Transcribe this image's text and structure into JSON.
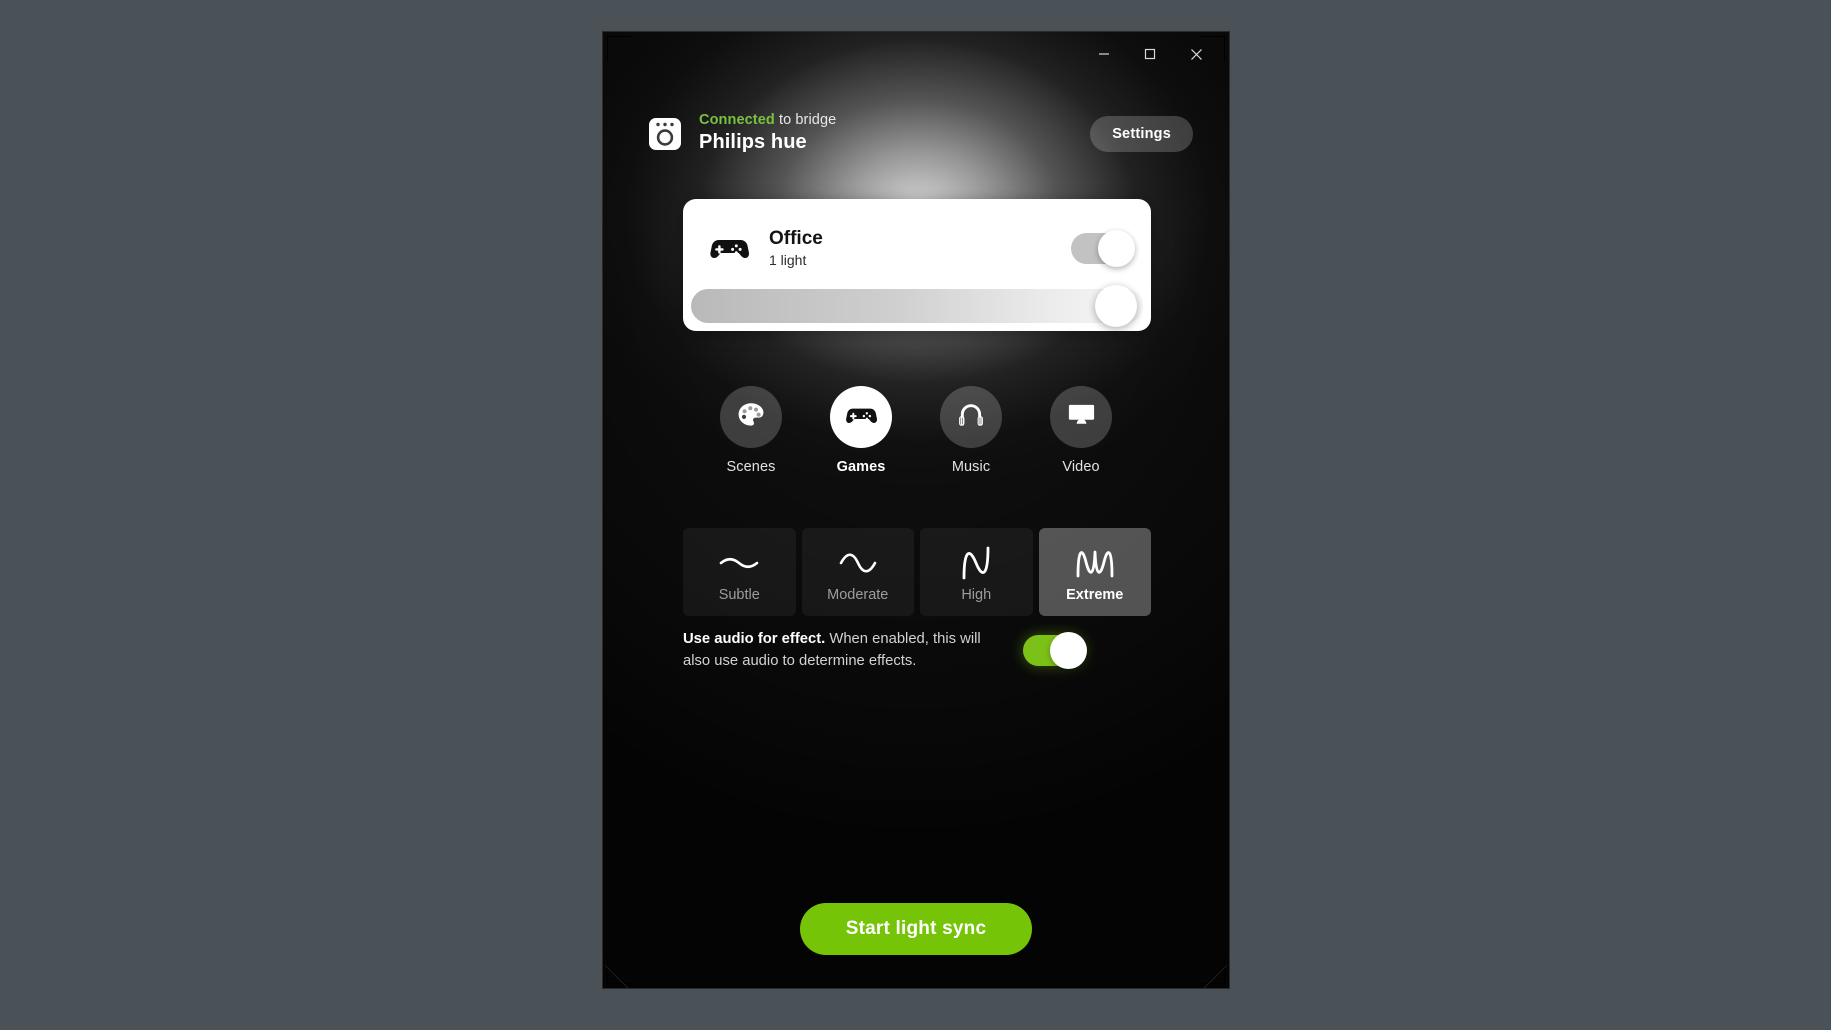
{
  "desktop": {
    "background_color": "#4b5257"
  },
  "window": {
    "background_color": "#0d0d0d",
    "accent_green": "#7cc118",
    "controls": {
      "minimize_label": "Minimize",
      "maximize_label": "Maximize",
      "close_label": "Close"
    }
  },
  "header": {
    "bridge_icon": "hue-bridge-icon",
    "status_connected": "Connected",
    "status_suffix": " to bridge",
    "bridge_name": "Philips hue",
    "settings_label": "Settings",
    "connected_color": "#7ac142"
  },
  "room_card": {
    "icon": "gamepad-icon",
    "name": "Office",
    "light_count_label": "1 light",
    "power_on": true,
    "brightness_percent": 95
  },
  "modes": {
    "selected": "Games",
    "items": [
      {
        "id": "scenes",
        "label": "Scenes",
        "icon": "palette-icon",
        "active": false
      },
      {
        "id": "games",
        "label": "Games",
        "icon": "gamepad-icon",
        "active": true
      },
      {
        "id": "music",
        "label": "Music",
        "icon": "headphones-icon",
        "active": false
      },
      {
        "id": "video",
        "label": "Video",
        "icon": "monitor-icon",
        "active": false
      }
    ]
  },
  "intensity": {
    "selected": "Extreme",
    "items": [
      {
        "id": "subtle",
        "label": "Subtle",
        "icon": "wave-flat-icon",
        "active": false
      },
      {
        "id": "moderate",
        "label": "Moderate",
        "icon": "wave-low-icon",
        "active": false
      },
      {
        "id": "high",
        "label": "High",
        "icon": "wave-medium-icon",
        "active": false
      },
      {
        "id": "extreme",
        "label": "Extreme",
        "icon": "wave-high-icon",
        "active": true
      }
    ]
  },
  "audio_option": {
    "title": "Use audio for effect.",
    "description": " When enabled, this will also use audio to determine effects.",
    "enabled": true
  },
  "start_button": {
    "label": "Start light sync"
  }
}
